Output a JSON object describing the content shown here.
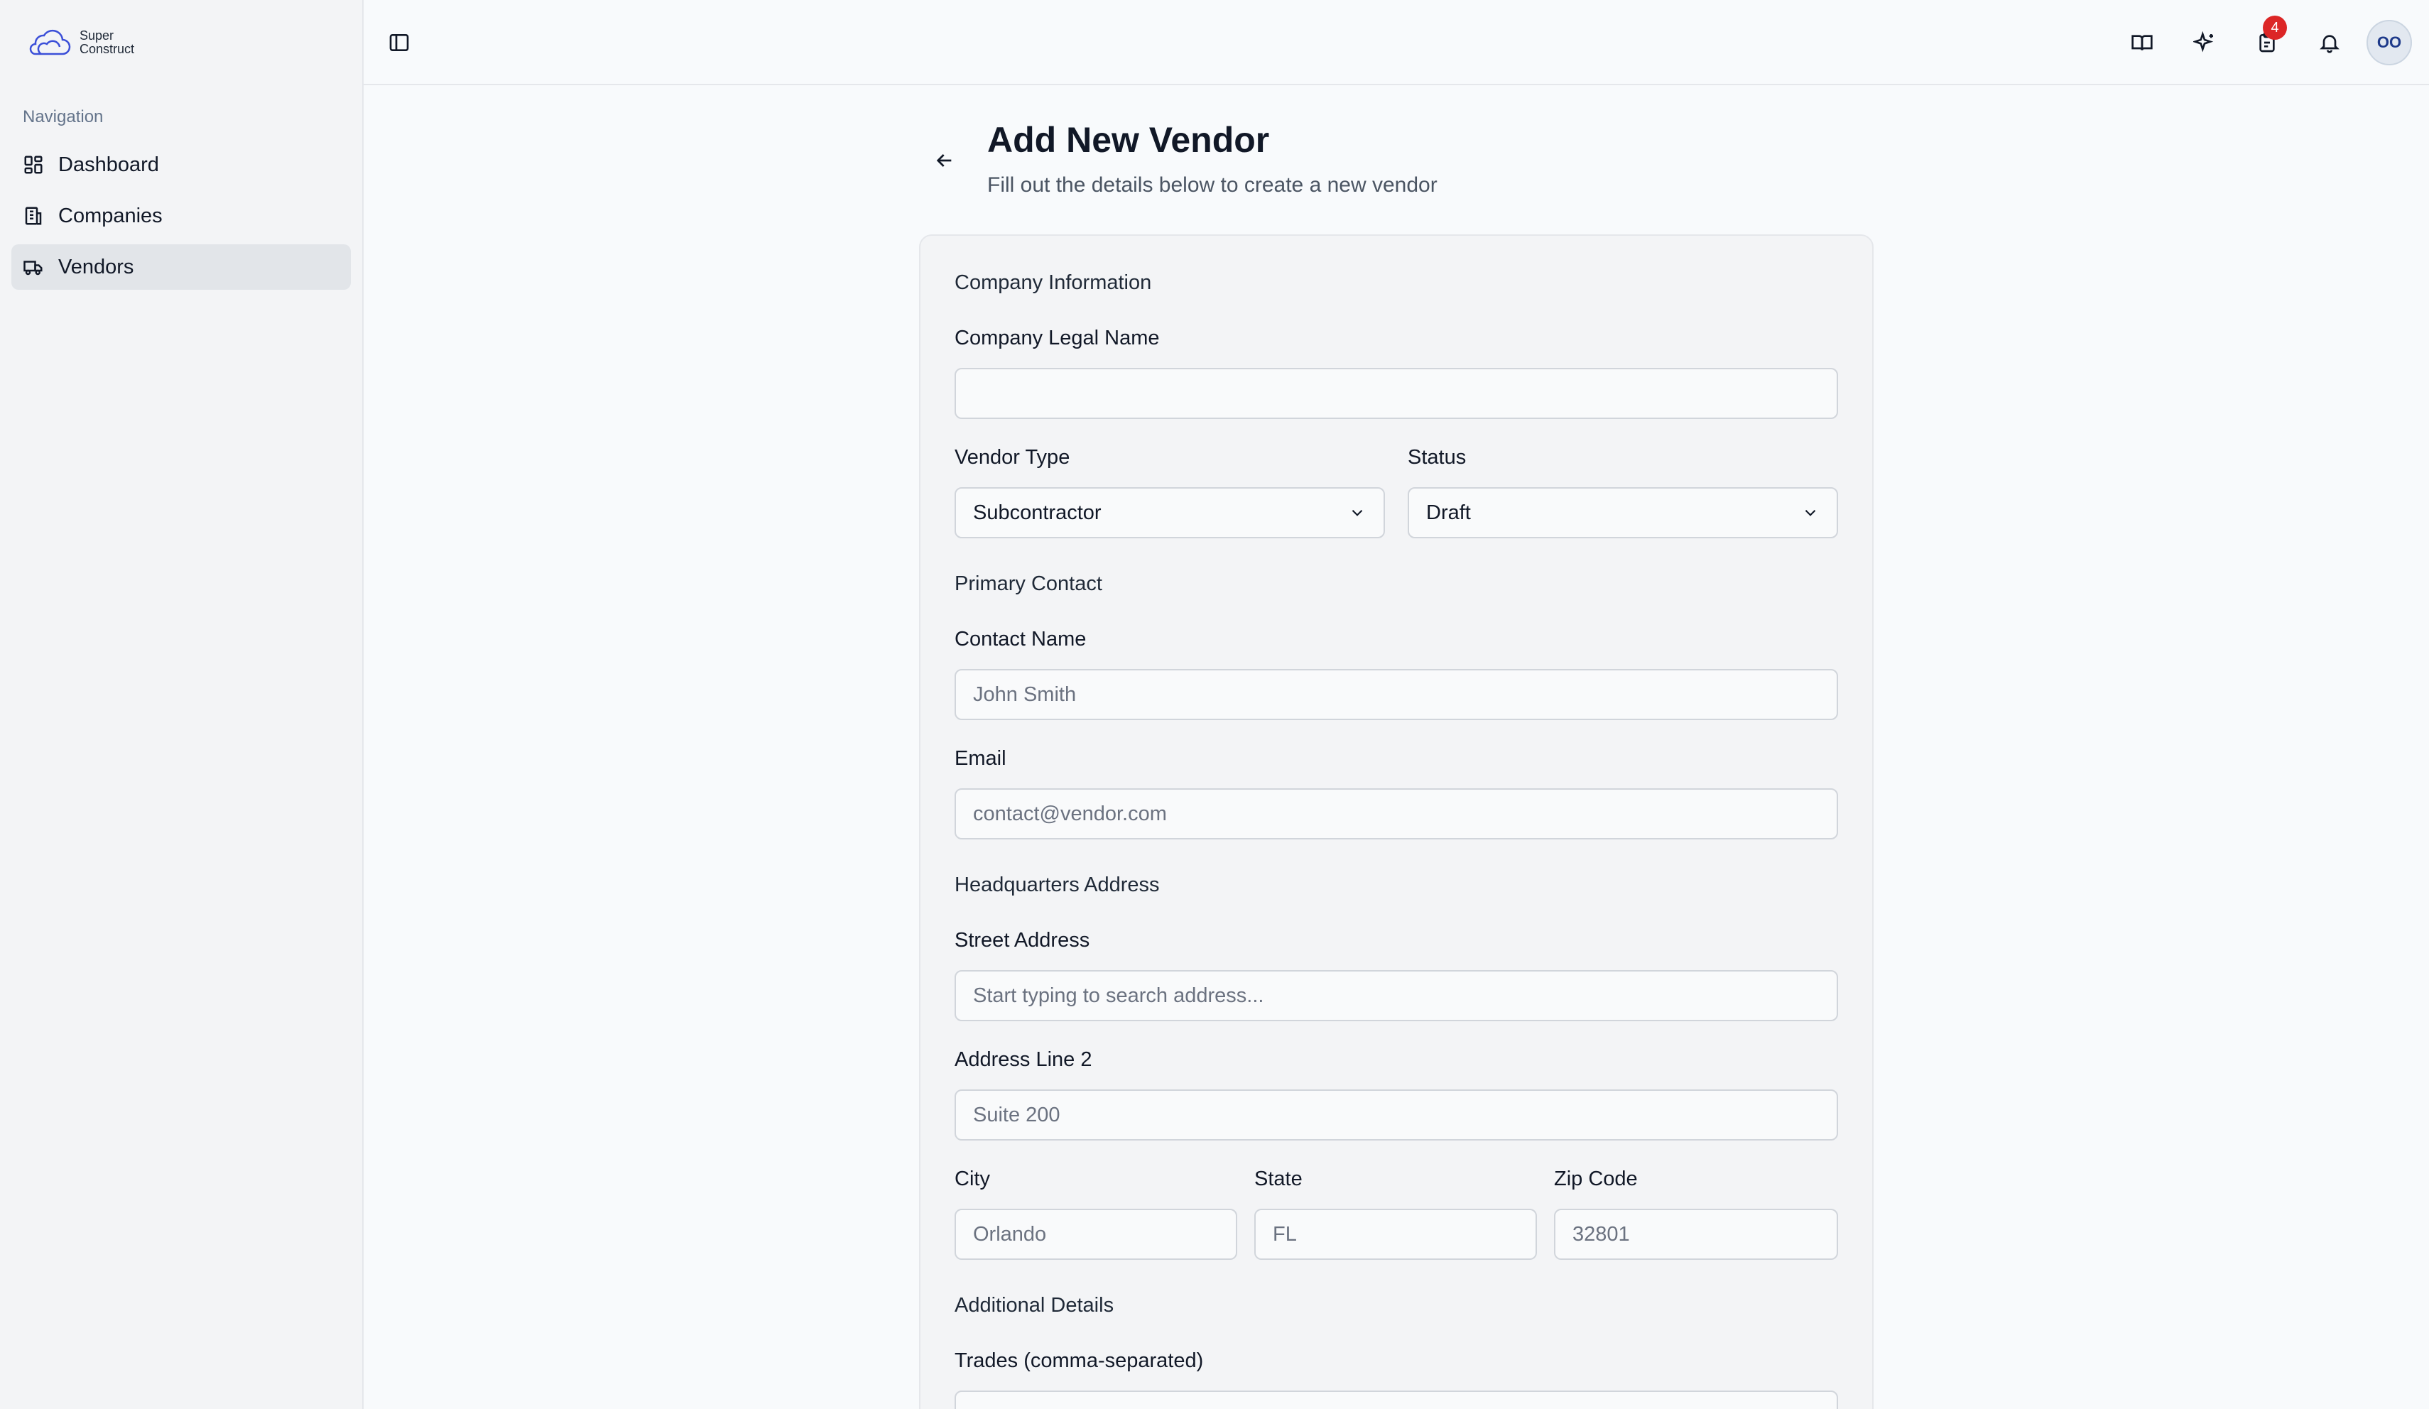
{
  "app": {
    "logo_line1": "Super",
    "logo_line2": "Construct"
  },
  "sidebar": {
    "heading": "Navigation",
    "items": [
      {
        "label": "Dashboard",
        "icon": "dashboard-icon"
      },
      {
        "label": "Companies",
        "icon": "building-icon"
      },
      {
        "label": "Vendors",
        "icon": "truck-icon",
        "active": true
      }
    ]
  },
  "topbar": {
    "badge_count": "4",
    "avatar_initials": "OO"
  },
  "page": {
    "title": "Add New Vendor",
    "subtitle": "Fill out the details below to create a new vendor"
  },
  "form": {
    "company_section": "Company Information",
    "legal_name_label": "Company Legal Name",
    "legal_name_value": "",
    "vendor_type_label": "Vendor Type",
    "vendor_type_value": "Subcontractor",
    "status_label": "Status",
    "status_value": "Draft",
    "contact_section": "Primary Contact",
    "contact_name_label": "Contact Name",
    "contact_name_placeholder": "John Smith",
    "email_label": "Email",
    "email_placeholder": "contact@vendor.com",
    "address_section": "Headquarters Address",
    "street_label": "Street Address",
    "street_placeholder": "Start typing to search address...",
    "address2_label": "Address Line 2",
    "address2_placeholder": "Suite 200",
    "city_label": "City",
    "city_placeholder": "Orlando",
    "state_label": "State",
    "state_placeholder": "FL",
    "zip_label": "Zip Code",
    "zip_placeholder": "32801",
    "additional_section": "Additional Details",
    "trades_label": "Trades (comma-separated)"
  },
  "colors": {
    "accent_badge": "#dc2626",
    "sidebar_bg": "#f3f4f6",
    "active_item_bg": "#e2e5e9"
  }
}
